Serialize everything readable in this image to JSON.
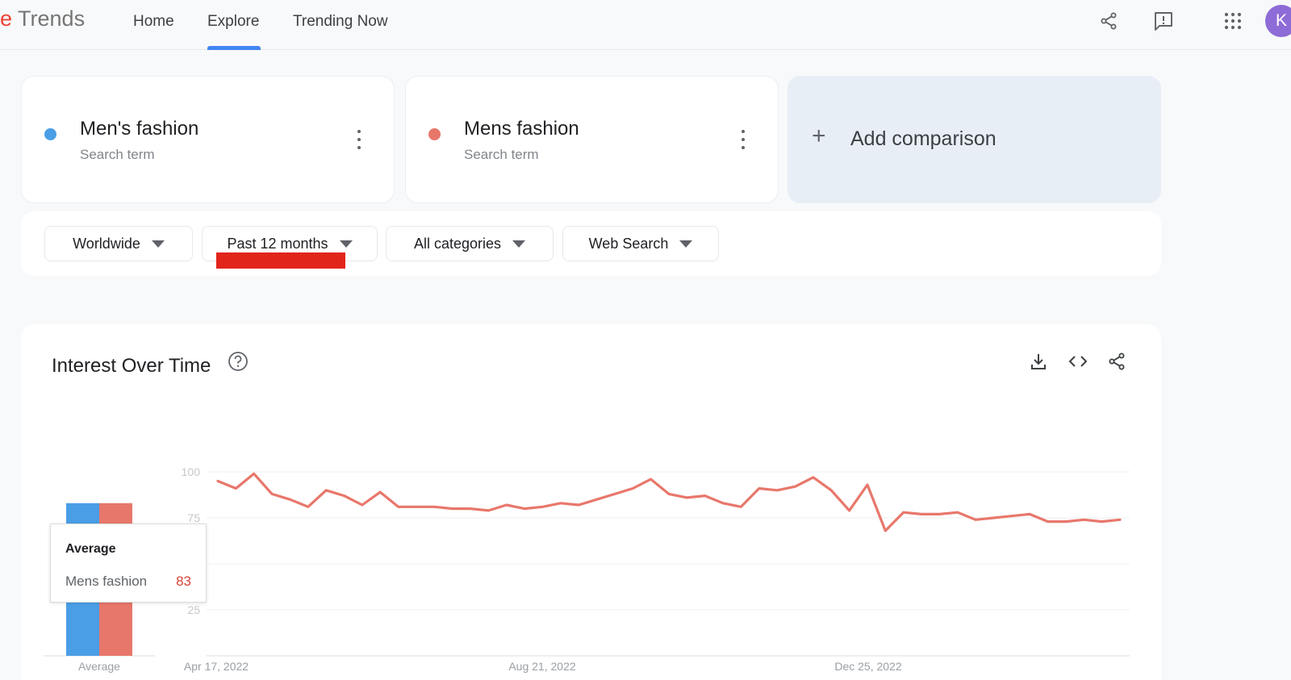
{
  "header": {
    "logo_prefix": "e",
    "logo_text": "Trends",
    "nav": [
      {
        "label": "Home"
      },
      {
        "label": "Explore"
      },
      {
        "label": "Trending Now"
      }
    ],
    "icons": [
      "share-icon",
      "feedback-icon",
      "apps-grid-icon"
    ],
    "avatar_letter": "K"
  },
  "terms": [
    {
      "name": "Men's fashion",
      "sub": "Search term",
      "color": "#4a9ee6"
    },
    {
      "name": "Mens fashion",
      "sub": "Search term",
      "color": "#e8776b"
    }
  ],
  "add_comparison": {
    "plus": "+",
    "label": "Add comparison"
  },
  "filters": [
    {
      "label": "Worldwide"
    },
    {
      "label": "Past 12 months"
    },
    {
      "label": "All categories"
    },
    {
      "label": "Web Search"
    }
  ],
  "chart": {
    "title": "Interest Over Time",
    "actions": [
      "download-icon",
      "embed-icon",
      "share-icon"
    ],
    "tooltip": {
      "title": "Average",
      "label": "Mens fashion",
      "value": "83"
    }
  },
  "chart_data": {
    "type": "line",
    "y_ticks": [
      "100",
      "75",
      "50",
      "25"
    ],
    "ylim": [
      0,
      100
    ],
    "x_labels": [
      "Apr 17, 2022",
      "Aug 21, 2022",
      "Dec 25, 2022"
    ],
    "average_bar": {
      "label": "Average",
      "values": [
        83,
        83
      ],
      "colors": [
        "#4a9ee6",
        "#e8776b"
      ]
    },
    "series": [
      {
        "name": "Mens fashion",
        "color": "#e8776b",
        "values": [
          95,
          91,
          99,
          88,
          85,
          81,
          90,
          87,
          82,
          89,
          81,
          81,
          81,
          80,
          80,
          79,
          82,
          80,
          81,
          83,
          82,
          85,
          88,
          91,
          96,
          88,
          86,
          87,
          83,
          81,
          91,
          90,
          92,
          97,
          90,
          79,
          93,
          68,
          78,
          77,
          77,
          78,
          74,
          75,
          76,
          77,
          73,
          73,
          74,
          73,
          74
        ]
      }
    ]
  }
}
